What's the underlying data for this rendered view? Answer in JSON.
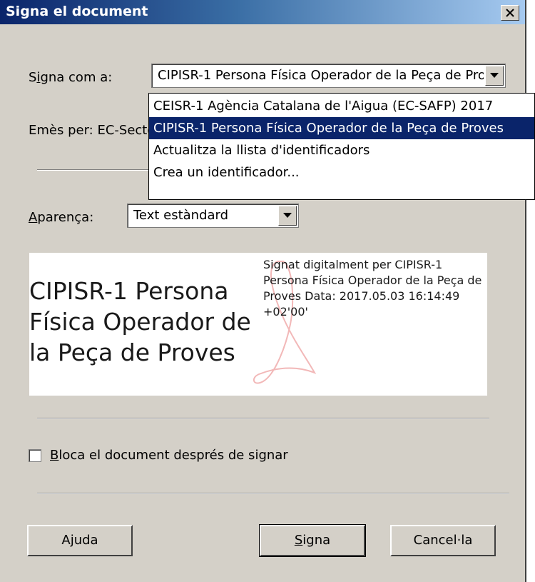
{
  "window": {
    "title": "Signa el document"
  },
  "sign_as": {
    "label_prefix": "S",
    "label_accel": "i",
    "label_rest": "gna com a:",
    "value": "CIPISR-1 Persona Física Operador de la Peça de Proves",
    "options": [
      "CEISR-1 Agència Catalana de l'Aigua (EC-SAFP) 2017",
      "CIPISR-1 Persona Física Operador de la Peça de Proves",
      "Actualitza la llista d'identificadors",
      "Crea un identificador..."
    ],
    "selected_index": 1
  },
  "issued_by": {
    "text": "Emès per: EC-Sector Públic"
  },
  "appearance": {
    "label_accel": "A",
    "label_rest": "parença:",
    "value": "Text estàndard"
  },
  "preview": {
    "name": "CIPISR-1 Persona Física Operador de la Peça de Proves",
    "details": "Signat digitalment per CIPISR-1 Persona Física Operador de la Peça de Proves Data: 2017.05.03 16:14:49 +02'00'"
  },
  "lock": {
    "label_accel": "B",
    "label_rest": "loca el document després de signar",
    "checked": false
  },
  "buttons": {
    "help": "Ajuda",
    "sign_accel": "S",
    "sign_rest": "igna",
    "cancel": "Cancel·la"
  }
}
